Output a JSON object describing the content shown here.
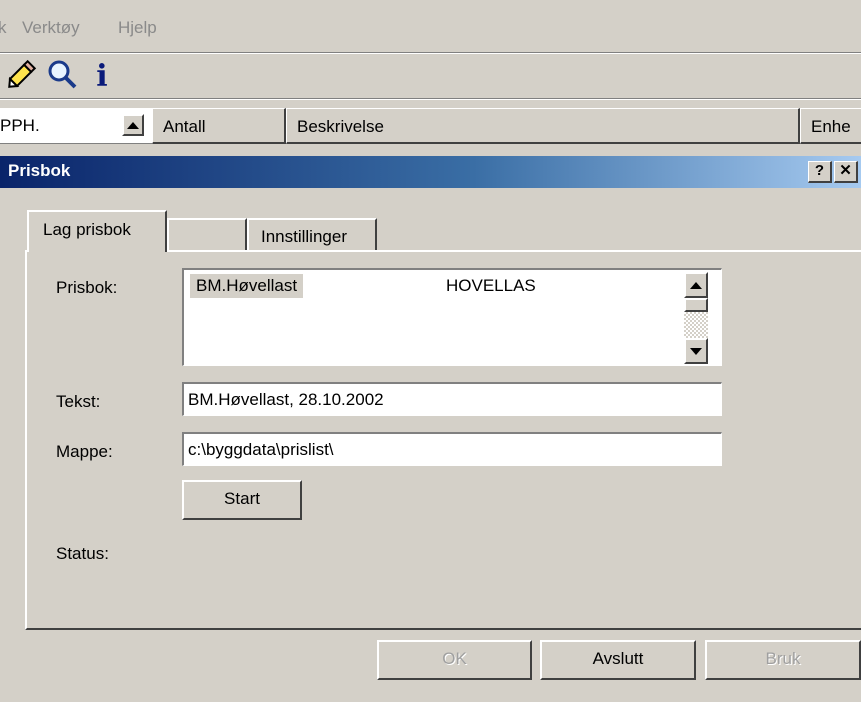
{
  "menu": {
    "items": [
      "k",
      "Verktøy",
      "Hjelp"
    ]
  },
  "toolbar": {
    "icons": [
      "pencil-icon",
      "search-icon",
      "info-icon"
    ],
    "info_glyph": "i"
  },
  "grid": {
    "combo_value": "PPH.",
    "columns": [
      "Antall",
      "Beskrivelse",
      "Enhe"
    ]
  },
  "dialog": {
    "title": "Prisbok",
    "help_glyph": "?",
    "close_glyph": "✕",
    "tabs": [
      "Lag prisbok",
      "",
      "Innstillinger"
    ],
    "labels": {
      "prisbok": "Prisbok:",
      "tekst": "Tekst:",
      "mappe": "Mappe:",
      "status": "Status:"
    },
    "prisbok_list": [
      {
        "name": "BM.Høvellast",
        "code": "HOVELLAS"
      }
    ],
    "tekst_value": "BM.Høvellast, 28.10.2002",
    "mappe_value": "c:\\byggdata\\prislist\\",
    "start_label": "Start",
    "buttons": {
      "ok": "OK",
      "avslutt": "Avslutt",
      "bruk": "Bruk"
    }
  }
}
